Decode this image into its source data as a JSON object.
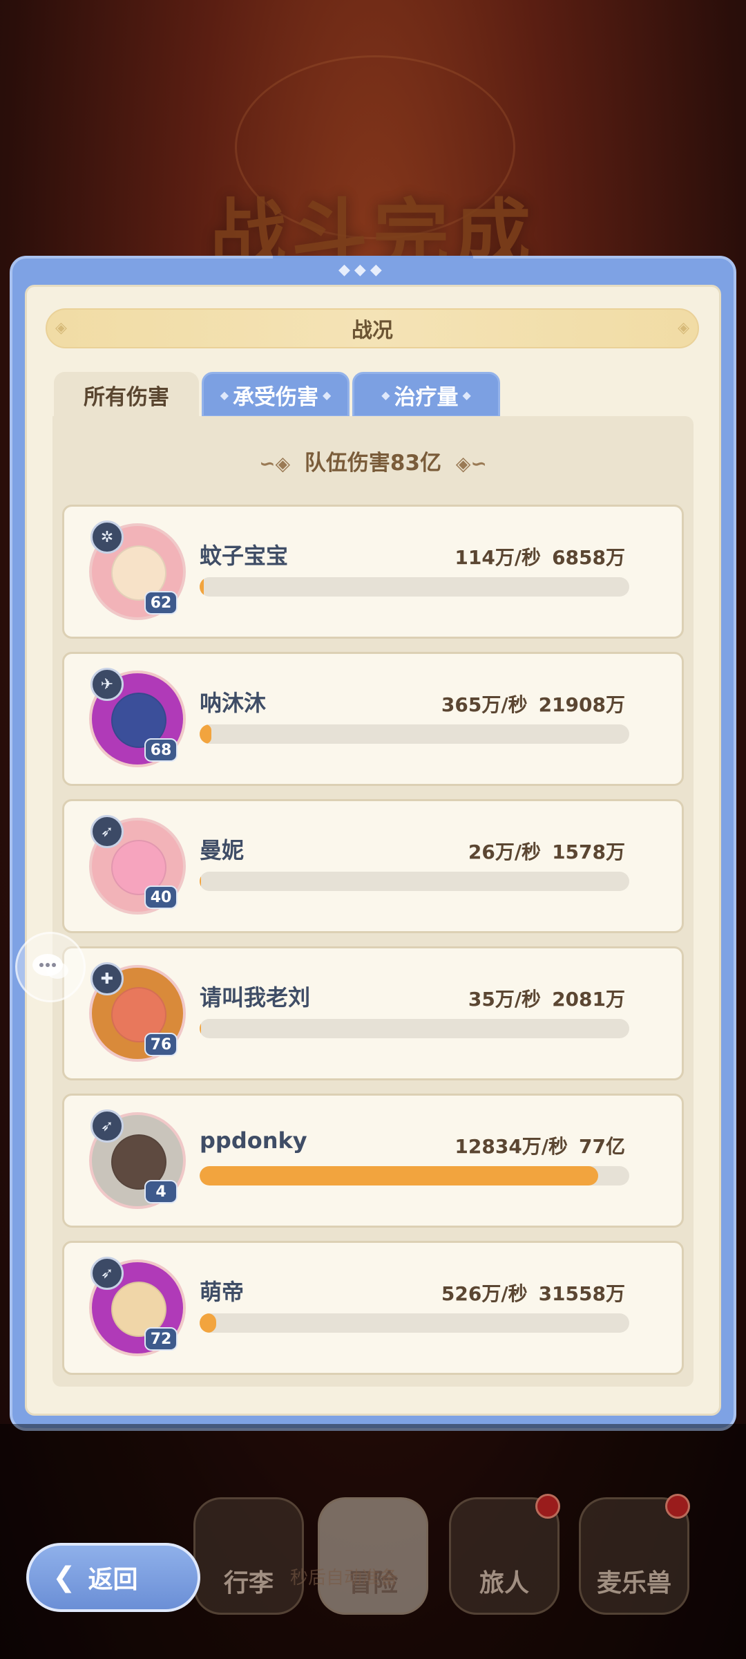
{
  "background": {
    "title": "战斗完成"
  },
  "panel": {
    "title": "战况",
    "tabs": [
      {
        "label": "所有伤害",
        "active": true
      },
      {
        "label": "承受伤害",
        "active": false
      },
      {
        "label": "治疗量",
        "active": false
      }
    ],
    "team_damage": "队伍伤害83亿"
  },
  "players": [
    {
      "name": "蚊子宝宝",
      "level": "62",
      "dps": "114万/秒",
      "total": "6858万",
      "share": 0.009,
      "class_icon": "star-class-icon",
      "ring_color": "#f2b3b8",
      "face_color": "#f7e2c8"
    },
    {
      "name": "呐沐沐",
      "level": "68",
      "dps": "365万/秒",
      "total": "21908万",
      "share": 0.027,
      "class_icon": "wing-class-icon",
      "ring_color": "#b03ab8",
      "face_color": "#3b4f9a"
    },
    {
      "name": "曼妮",
      "level": "40",
      "dps": "26万/秒",
      "total": "1578万",
      "share": 0.002,
      "class_icon": "bow-class-icon",
      "ring_color": "#f2b3b8",
      "face_color": "#f6a4be"
    },
    {
      "name": "请叫我老刘",
      "level": "76",
      "dps": "35万/秒",
      "total": "2081万",
      "share": 0.003,
      "class_icon": "cross-class-icon",
      "ring_color": "#d98a3a",
      "face_color": "#e8785c"
    },
    {
      "name": "ppdonky",
      "level": "4",
      "dps": "12834万/秒",
      "total": "77亿",
      "share": 0.928,
      "class_icon": "bow-class-icon",
      "ring_color": "#c9c4bb",
      "face_color": "#5e4a40"
    },
    {
      "name": "萌帝",
      "level": "72",
      "dps": "526万/秒",
      "total": "31558万",
      "share": 0.038,
      "class_icon": "bow-class-icon",
      "ring_color": "#b03ab8",
      "face_color": "#f0d6a8"
    }
  ],
  "nav": {
    "items": [
      {
        "label": "行李",
        "badge": false
      },
      {
        "label": "冒险",
        "badge": false
      },
      {
        "label": "旅人",
        "badge": true
      },
      {
        "label": "麦乐兽",
        "badge": true
      }
    ],
    "back_label": "返回",
    "hint": "秒后自动准备"
  },
  "colors": {
    "accent_blue": "#7ea2e4",
    "bar_fill": "#f2a43e",
    "panel_bg": "#f6f0df"
  }
}
